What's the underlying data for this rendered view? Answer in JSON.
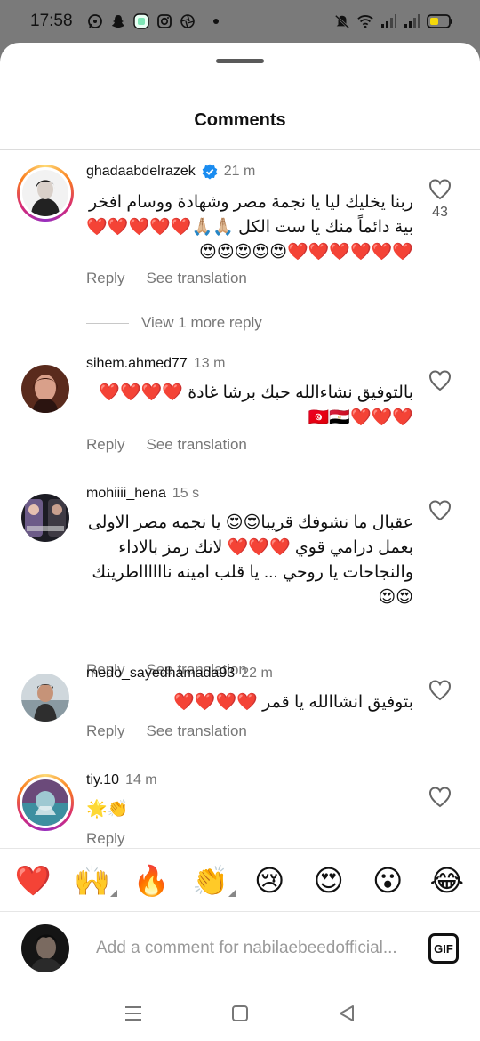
{
  "status_bar": {
    "time": "17:58",
    "icons_left": [
      "whatsapp-icon",
      "snapchat-icon",
      "app-icon",
      "instagram-icon",
      "aperture-icon"
    ],
    "icons_right": [
      "mute-icon",
      "wifi-icon",
      "signal-icon",
      "signal-icon",
      "battery-icon"
    ]
  },
  "sheet": {
    "title": "Comments"
  },
  "comments": [
    {
      "username": "ghadaabdelrazek",
      "verified": true,
      "time": "21 m",
      "text": "ربنا يخليك ليا يا نجمة مصر وشهادة ووسام افخر بية دائماً منك يا ست الكل 🙏🏼🙏🏼❤️❤️❤️❤️❤️❤️❤️❤️❤️❤️❤️😍😍😍😍😍",
      "reply_label": "Reply",
      "translate_label": "See translation",
      "likes": "43"
    },
    {
      "username": "sihem.ahmed77",
      "time": "13 m",
      "text": "بالتوفيق نشاءالله حبك برشا غادة ❤️❤️❤️❤️❤️❤️❤️🇹🇳🇪🇬",
      "reply_label": "Reply",
      "translate_label": "See translation"
    },
    {
      "username": "mohiiii_hena",
      "time": "15 s",
      "text": "عقبال ما نشوفك قريبا😍😍 يا نجمه مصر الاولى بعمل درامي قوي ❤️❤️❤️ لانك رمز بالاداء والنجاحات يا روحي ... يا قلب امينه نااااااطرينك 😍😍",
      "reply_label": "Reply",
      "translate_label": "See translation"
    },
    {
      "username": "medo_sayedhamada93",
      "time": "22 m",
      "text": "بتوفيق انشاالله يا قمر ❤️❤️❤️❤️",
      "reply_label": "Reply",
      "translate_label": "See translation"
    },
    {
      "username": "tiy.10",
      "time": "14 m",
      "text": "🌟👏",
      "reply_label": "Reply"
    }
  ],
  "view_more": "View 1 more reply",
  "reactions": [
    "❤️",
    "🙌",
    "🔥",
    "👏",
    "😢",
    "😍",
    "😮",
    "😂"
  ],
  "composer": {
    "placeholder": "Add a comment for nabilaebeedofficial...",
    "gif_label": "GIF"
  },
  "navbar": {
    "icons": [
      "recents-icon",
      "home-icon",
      "back-icon"
    ]
  }
}
